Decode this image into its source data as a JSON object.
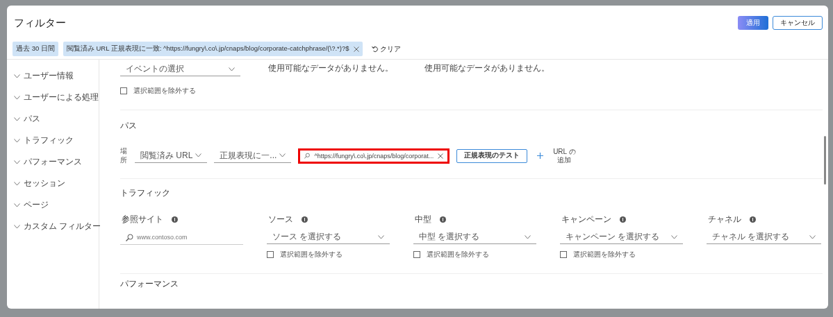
{
  "dialog": {
    "title": "フィルター",
    "buttons": [
      {
        "label": "適用",
        "kind": "primary"
      },
      {
        "label": "キャンセル",
        "kind": "secondary"
      }
    ]
  },
  "chips": [
    {
      "label": "過去 30 日間",
      "removable": false
    },
    {
      "label": "閲覧済み URL 正規表現に一致: ^https://fungry\\.co\\.jp/cnaps/blog/corporate-catchphrase/(\\?.*)?$",
      "removable": true
    }
  ],
  "clear_button": {
    "label": "クリア"
  },
  "sidebar": {
    "items": [
      {
        "label": "ユーザー情報",
        "expanded": false
      },
      {
        "label": "ユーザーによる処理",
        "expanded": false
      },
      {
        "label": "パス",
        "expanded": false
      },
      {
        "label": "トラフィック",
        "expanded": false
      },
      {
        "label": "パフォーマンス",
        "expanded": false
      },
      {
        "label": "セッション",
        "expanded": false
      },
      {
        "label": "ページ",
        "expanded": false
      },
      {
        "label": "カスタム フィルター",
        "expanded": false
      }
    ]
  },
  "event_section": {
    "event_dropdown": {
      "placeholder": "イベントの選択"
    },
    "exclude": {
      "label": "選択範囲を除外する",
      "checked": false
    },
    "no_data": [
      "使用可能なデータがありません。",
      "使用可能なデータがありません。"
    ]
  },
  "path_section": {
    "title": "パス",
    "location_label": "場所",
    "dropdowns": [
      {
        "value": "閲覧済み URL"
      },
      {
        "value": "正規表現に一..."
      }
    ],
    "regex_field": {
      "value": "^https://fungry\\.co\\.jp/cnaps/blog/corporat...",
      "highlighted": true
    },
    "test_button": "正規表現のテスト",
    "add_url": "URL の追加"
  },
  "traffic_section": {
    "title": "トラフィック",
    "fields": [
      {
        "kind": "search",
        "label": "参照サイト",
        "placeholder": "www.contoso.com"
      },
      {
        "kind": "dropdown",
        "label": "ソース",
        "placeholder": "ソース を選択する",
        "exclude": {
          "label": "選択範囲を除外する",
          "checked": false
        }
      },
      {
        "kind": "dropdown",
        "label": "中型",
        "placeholder": "中型 を選択する",
        "exclude": {
          "label": "選択範囲を除外する",
          "checked": false
        }
      },
      {
        "kind": "dropdown",
        "label": "キャンペーン",
        "placeholder": "キャンペーン を選択する",
        "exclude": {
          "label": "選択範囲を除外する",
          "checked": false
        }
      },
      {
        "kind": "dropdown",
        "label": "チャネル",
        "placeholder": "チャネル を選択する"
      }
    ]
  },
  "next_section": {
    "title": "パフォーマンス"
  }
}
